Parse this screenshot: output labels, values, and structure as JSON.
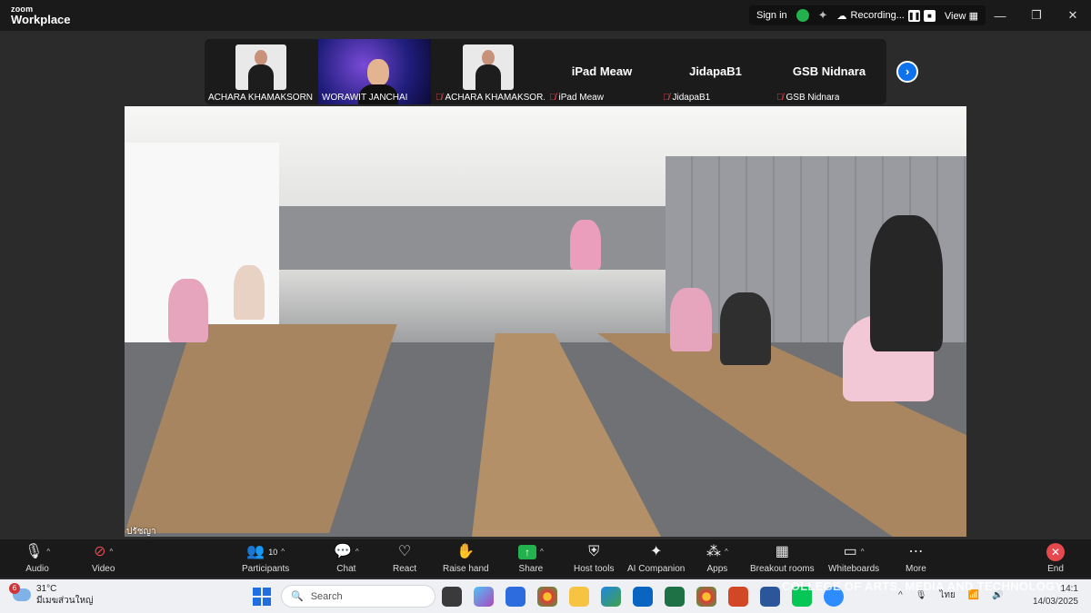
{
  "app": {
    "brand_small": "zoom",
    "brand_name": "Workplace"
  },
  "topbar": {
    "sign_in": "Sign in",
    "recording": "Recording...",
    "view": "View"
  },
  "participants_strip": [
    {
      "name": "ACHARA KHAMAKSORN",
      "muted": false,
      "type": "photo"
    },
    {
      "name": "WORAWIT JANCHAI",
      "muted": false,
      "type": "video"
    },
    {
      "name": "ACHARA KHAMAKSOR...",
      "muted": true,
      "type": "photo"
    },
    {
      "name": "iPad Meaw",
      "display": "iPad Meaw",
      "muted": true,
      "type": "name"
    },
    {
      "name": "JidapaB1",
      "display": "JidapaB1",
      "muted": true,
      "type": "name"
    },
    {
      "name": "GSB Nidnara",
      "display": "GSB Nidnara",
      "muted": true,
      "type": "name"
    }
  ],
  "main_video": {
    "speaker_label": "ปรัชญา"
  },
  "toolbar": {
    "audio": "Audio",
    "video": "Video",
    "participants": "Participants",
    "participants_count": "10",
    "chat": "Chat",
    "react": "React",
    "raise_hand": "Raise hand",
    "share": "Share",
    "host_tools": "Host tools",
    "ai_companion": "AI Companion",
    "apps": "Apps",
    "breakout_rooms": "Breakout rooms",
    "whiteboards": "Whiteboards",
    "more": "More",
    "end": "End"
  },
  "taskbar": {
    "temperature": "31°C",
    "location": "มีเมฆส่วนใหญ่",
    "weather_badge": "6",
    "search_placeholder": "Search",
    "lang": "ไทย",
    "time": "14:1",
    "date": "14/03/2025"
  },
  "watermark": "COLLEGE OF ARTS, MEDIA AND TECHNOLOGY",
  "colors": {
    "accent": "#0e72ed",
    "end": "#e5484d",
    "share": "#22b14c"
  }
}
